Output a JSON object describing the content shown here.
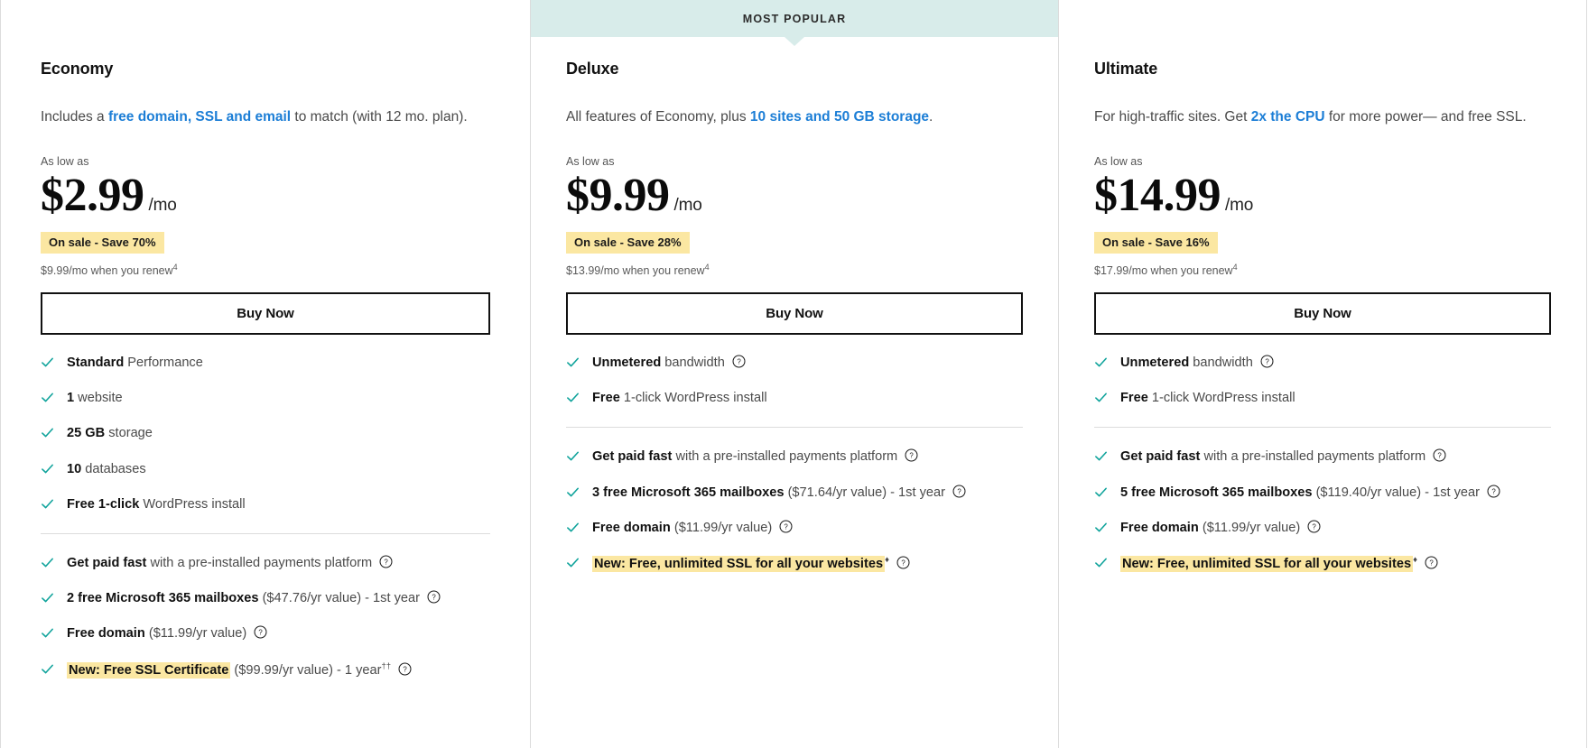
{
  "plans": [
    {
      "id": "economy",
      "title": "Economy",
      "popular_label": null,
      "tagline": {
        "before": "Includes a ",
        "link": "free domain, SSL and email",
        "after": " to match (with 12 mo. plan)."
      },
      "as_low_as": "As low as",
      "price": "$2.99",
      "period": "/mo",
      "sale_badge": "On sale - Save 70%",
      "renew_note": "$9.99/mo when you renew",
      "renew_note_sup": "4",
      "buy_label": "Buy Now",
      "features_top": [
        {
          "bold": "Standard",
          "rest": " Performance",
          "info": false
        },
        {
          "bold": "1",
          "rest": " website",
          "info": false
        },
        {
          "bold": "25 GB",
          "rest": " storage",
          "info": false
        },
        {
          "bold": "10",
          "rest": " databases",
          "info": false
        },
        {
          "bold": "Free 1-click",
          "rest": " WordPress install",
          "info": false
        }
      ],
      "features_bottom": [
        {
          "bold": "Get paid fast",
          "rest": " with a pre-installed payments platform",
          "info": true
        },
        {
          "bold": "2 free Microsoft 365 mailboxes",
          "rest": " ($47.76/yr value) - 1st year",
          "info": true
        },
        {
          "bold": "Free domain",
          "rest": " ($11.99/yr value)",
          "info": true
        },
        {
          "highlight": "New: Free SSL Certificate",
          "rest": " ($99.99/yr value) - 1 year",
          "sup": "††",
          "info": true
        }
      ]
    },
    {
      "id": "deluxe",
      "title": "Deluxe",
      "popular_label": "MOST POPULAR",
      "tagline": {
        "before": "All features of Economy, plus ",
        "link": "10 sites and 50 GB storage",
        "after": "."
      },
      "as_low_as": "As low as",
      "price": "$9.99",
      "period": "/mo",
      "sale_badge": "On sale - Save 28%",
      "renew_note": "$13.99/mo when you renew",
      "renew_note_sup": "4",
      "buy_label": "Buy Now",
      "features_top": [
        {
          "bold": "Unmetered",
          "rest": " bandwidth",
          "info": true
        },
        {
          "bold": "Free",
          "rest": " 1-click WordPress install",
          "info": false
        }
      ],
      "features_bottom": [
        {
          "bold": "Get paid fast",
          "rest": " with a pre-installed payments platform",
          "info": true
        },
        {
          "bold": "3 free Microsoft 365 mailboxes",
          "rest": " ($71.64/yr value) - 1st year",
          "info": true
        },
        {
          "bold": "Free domain",
          "rest": " ($11.99/yr value)",
          "info": true
        },
        {
          "highlight": "New: Free, unlimited SSL for all your websites",
          "rest": "",
          "sup": "♦",
          "info": true
        }
      ]
    },
    {
      "id": "ultimate",
      "title": "Ultimate",
      "popular_label": null,
      "tagline": {
        "before": "For high-traffic sites. Get ",
        "link": "2x the CPU",
        "after": " for more power— and free SSL."
      },
      "as_low_as": "As low as",
      "price": "$14.99",
      "period": "/mo",
      "sale_badge": "On sale - Save 16%",
      "renew_note": "$17.99/mo when you renew",
      "renew_note_sup": "4",
      "buy_label": "Buy Now",
      "features_top": [
        {
          "bold": "Unmetered",
          "rest": " bandwidth",
          "info": true
        },
        {
          "bold": "Free",
          "rest": " 1-click WordPress install",
          "info": false
        }
      ],
      "features_bottom": [
        {
          "bold": "Get paid fast",
          "rest": " with a pre-installed payments platform",
          "info": true
        },
        {
          "bold": "5 free Microsoft 365 mailboxes",
          "rest": " ($119.40/yr value) - 1st year",
          "info": true
        },
        {
          "bold": "Free domain",
          "rest": " ($11.99/yr value)",
          "info": true
        },
        {
          "highlight": "New: Free, unlimited SSL for all your websites",
          "rest": "",
          "sup": "♦",
          "info": true
        }
      ]
    }
  ],
  "colors": {
    "popular_banner_bg": "#d8ecea",
    "sale_badge_bg": "#fbe7a2",
    "highlight_bg": "#fbe7a2",
    "check": "#0fa39b",
    "link": "#1c7ed6",
    "button_border": "#111111",
    "divider": "#dcdcdc"
  },
  "icons": {
    "check": "check-icon",
    "info": "info-circle-icon"
  }
}
